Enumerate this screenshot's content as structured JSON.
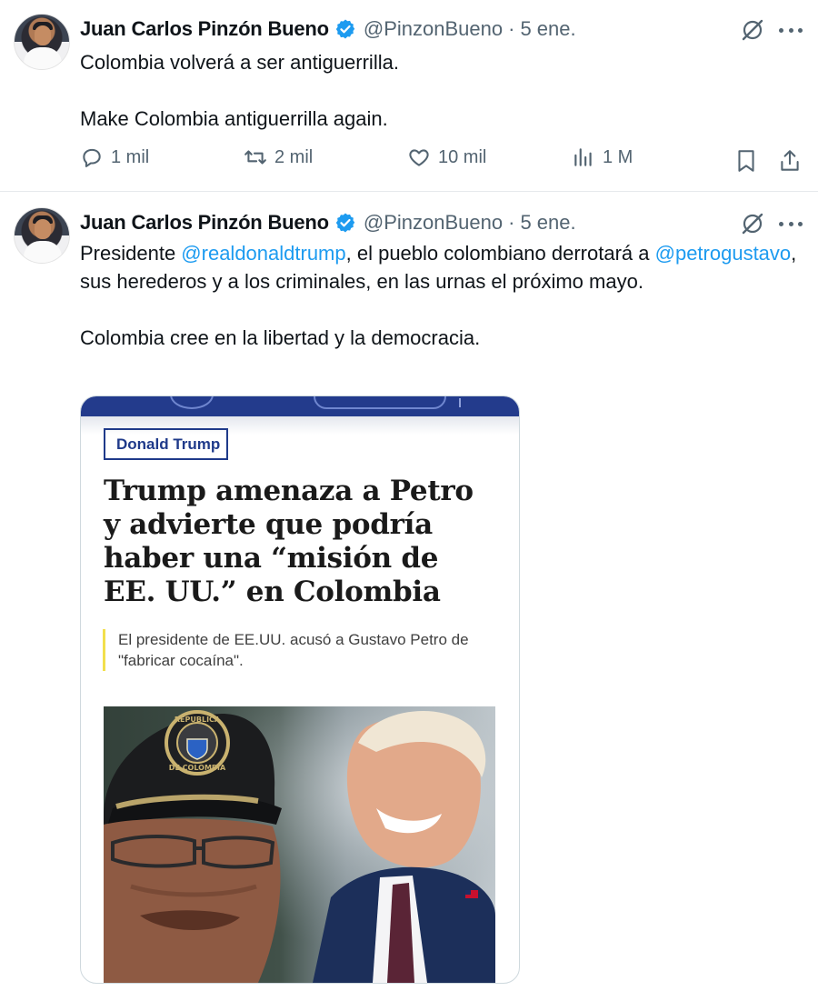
{
  "tweets": [
    {
      "author_name": "Juan Carlos Pinzón Bueno",
      "handle": "@PinzonBueno",
      "separator": "·",
      "date": "5 ene.",
      "lines": [
        "Colombia volverá a ser antiguerrilla.",
        "Make Colombia antiguerrilla again."
      ],
      "replies": "1 mil",
      "reposts": "2 mil",
      "likes": "10 mil",
      "views": "1 M"
    },
    {
      "author_name": "Juan Carlos Pinzón Bueno",
      "handle": "@PinzonBueno",
      "separator": "·",
      "date": "5 ene.",
      "para1": {
        "pre": "Presidente ",
        "mention1": "@realdonaldtrump",
        "mid": ", el pueblo colombiano derrotará a ",
        "mention2": "@petrogustavo",
        "post": ", sus herederos y a los criminales, en las urnas el próximo mayo."
      },
      "para2": "Colombia cree en la libertad y la democracia.",
      "card": {
        "tag": "Donald Trump",
        "headline": "Trump amenaza a Petro y advierte que podría haber una “misión de EE. UU.” en Colombia",
        "summary": "El presidente de EE.UU. acusó a Gustavo Petro de \"fabricar cocaína\".",
        "cap_text_top": "REPUBLICA",
        "cap_text_bottom": "DE COLOMBIA"
      }
    }
  ],
  "colors": {
    "accent": "#1d9bf0",
    "muted": "#536471",
    "verified": "#1d9bf0",
    "card_navy": "#233b8c",
    "quote_bar": "#f2df4c"
  },
  "icons": [
    "verified-badge-icon",
    "grok-icon",
    "more-icon",
    "reply-icon",
    "repost-icon",
    "like-icon",
    "views-icon",
    "bookmark-icon",
    "share-icon"
  ]
}
